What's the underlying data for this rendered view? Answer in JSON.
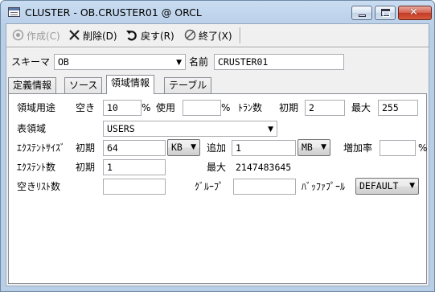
{
  "window": {
    "title": "CLUSTER - OB.CRUSTER01 @ ORCL"
  },
  "toolbar": {
    "create_label": "作成(C)",
    "delete_label": "削除(D)",
    "revert_label": "戻す(R)",
    "exit_label": "終了(X)"
  },
  "header": {
    "schema_label": "スキーマ",
    "schema_value": "OB",
    "name_label": "名前",
    "name_value": "CRUSTER01"
  },
  "tabs": [
    {
      "label": "定義情報"
    },
    {
      "label": "ソース"
    },
    {
      "label": "領域情報"
    },
    {
      "label": "テーブル"
    }
  ],
  "storage": {
    "usage_label": "領域用途",
    "free_label": "空き",
    "free_value": "10",
    "free_unit": "%",
    "used_label": "使用",
    "used_value": "",
    "used_unit": "%",
    "tran_label": "ﾄﾗﾝ数",
    "tran_initial_label": "初期",
    "tran_initial_value": "2",
    "tran_max_label": "最大",
    "tran_max_value": "255",
    "tablespace_label": "表領域",
    "tablespace_value": "USERS",
    "extent_size_label": "ｴｸｽﾃﾝﾄｻｲｽﾞ",
    "extent_size_initial_label": "初期",
    "extent_size_initial_value": "64",
    "extent_size_initial_unit": "KB",
    "extent_size_next_label": "追加",
    "extent_size_next_value": "1",
    "extent_size_next_unit": "MB",
    "increase_label": "増加率",
    "increase_value": "",
    "increase_unit": "%",
    "extent_count_label": "ｴｸｽﾃﾝﾄ数",
    "extent_count_initial_label": "初期",
    "extent_count_initial_value": "1",
    "extent_count_max_label": "最大",
    "extent_count_max_value": "2147483645",
    "freelist_label": "空きﾘｽﾄ数",
    "freelist_value": "",
    "group_label": "ｸﾞﾙｰﾌﾟ",
    "group_value": "",
    "bufferpool_label": "ﾊﾞｯﾌｧﾌﾟｰﾙ",
    "bufferpool_value": "DEFAULT"
  }
}
